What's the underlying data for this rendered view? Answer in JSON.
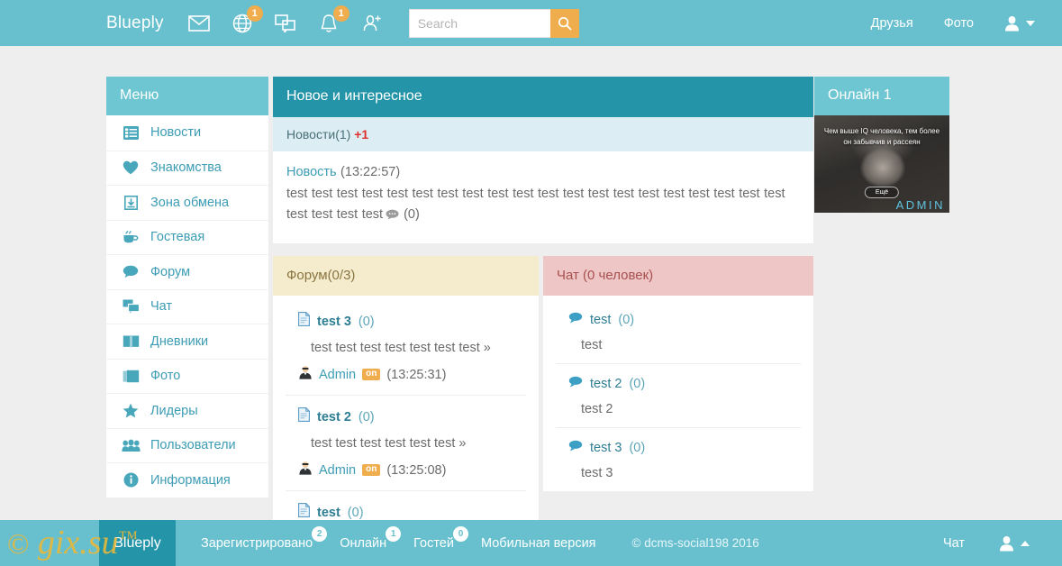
{
  "header": {
    "brand": "Blueply",
    "icons": [
      {
        "name": "mail-icon",
        "badge": null
      },
      {
        "name": "globe-icon",
        "badge": "1"
      },
      {
        "name": "messages-icon",
        "badge": null
      },
      {
        "name": "bell-icon",
        "badge": "1"
      },
      {
        "name": "add-friend-icon",
        "badge": null
      }
    ],
    "search": {
      "value": "",
      "placeholder": "Search"
    },
    "nav": [
      {
        "label": "Друзья"
      },
      {
        "label": "Фото"
      }
    ]
  },
  "sidebar": {
    "title": "Меню",
    "items": [
      {
        "label": "Новости",
        "icon": "news-list-icon"
      },
      {
        "label": "Знакомства",
        "icon": "heart-icon"
      },
      {
        "label": "Зона обмена",
        "icon": "download-box-icon"
      },
      {
        "label": "Гостевая",
        "icon": "cup-icon"
      },
      {
        "label": "Форум",
        "icon": "speech-bubble-icon"
      },
      {
        "label": "Чат",
        "icon": "chat-bubbles-icon"
      },
      {
        "label": "Дневники",
        "icon": "book-icon"
      },
      {
        "label": "Фото",
        "icon": "photos-icon"
      },
      {
        "label": "Лидеры",
        "icon": "star-icon"
      },
      {
        "label": "Пользователи",
        "icon": "users-icon"
      },
      {
        "label": "Информация",
        "icon": "info-icon"
      }
    ]
  },
  "main": {
    "title": "Новое и интересное",
    "news_section": {
      "label": "Новости(1)",
      "increment": "+1",
      "item": {
        "title": "Новость",
        "time": "(13:22:57)",
        "text": "test test test test test test test test test test test test test test test test test test test test test test test test",
        "comments": "(0)"
      }
    },
    "forum": {
      "title": "Форум(0/3)",
      "items": [
        {
          "title": "test 3",
          "count": "(0)",
          "preview": "test test test test test test test »",
          "author": "Admin",
          "status": "on",
          "time": "(13:25:31)"
        },
        {
          "title": "test 2",
          "count": "(0)",
          "preview": "test test test test test test »",
          "author": "Admin",
          "status": "on",
          "time": "(13:25:08)"
        },
        {
          "title": "test",
          "count": "(0)",
          "preview": "",
          "author": "",
          "status": "",
          "time": ""
        }
      ]
    },
    "chat": {
      "title": "Чат (0 человек)",
      "items": [
        {
          "title": "test",
          "count": "(0)",
          "message": "test"
        },
        {
          "title": "test 2",
          "count": "(0)",
          "message": "test 2"
        },
        {
          "title": "test 3",
          "count": "(0)",
          "message": "test 3"
        }
      ]
    }
  },
  "online": {
    "title": "Онлайн 1",
    "avatar_quote": "Чем выше IQ человека, тем более он забывчив и рассеян",
    "avatar_button": "Ещё",
    "username": "ADMIN"
  },
  "footer": {
    "logo": "Blueply",
    "stats": [
      {
        "label": "Зарегистрировано",
        "badge": "2"
      },
      {
        "label": "Онлайн",
        "badge": "1"
      },
      {
        "label": "Гостей",
        "badge": "0"
      },
      {
        "label": "Мобильная версия",
        "badge": null
      }
    ],
    "copyright": "© dcms-social198 2016",
    "chat_link": "Чат"
  },
  "watermark": {
    "text": "gix.su"
  },
  "colors": {
    "brand_teal": "#68c0ce",
    "dark_teal": "#2494a8",
    "accent_orange": "#f0ad4e",
    "link_blue": "#3c9cb4",
    "forum_cream": "#f5eccd",
    "chat_pink": "#eec6c6",
    "alert_red": "#e03030"
  }
}
